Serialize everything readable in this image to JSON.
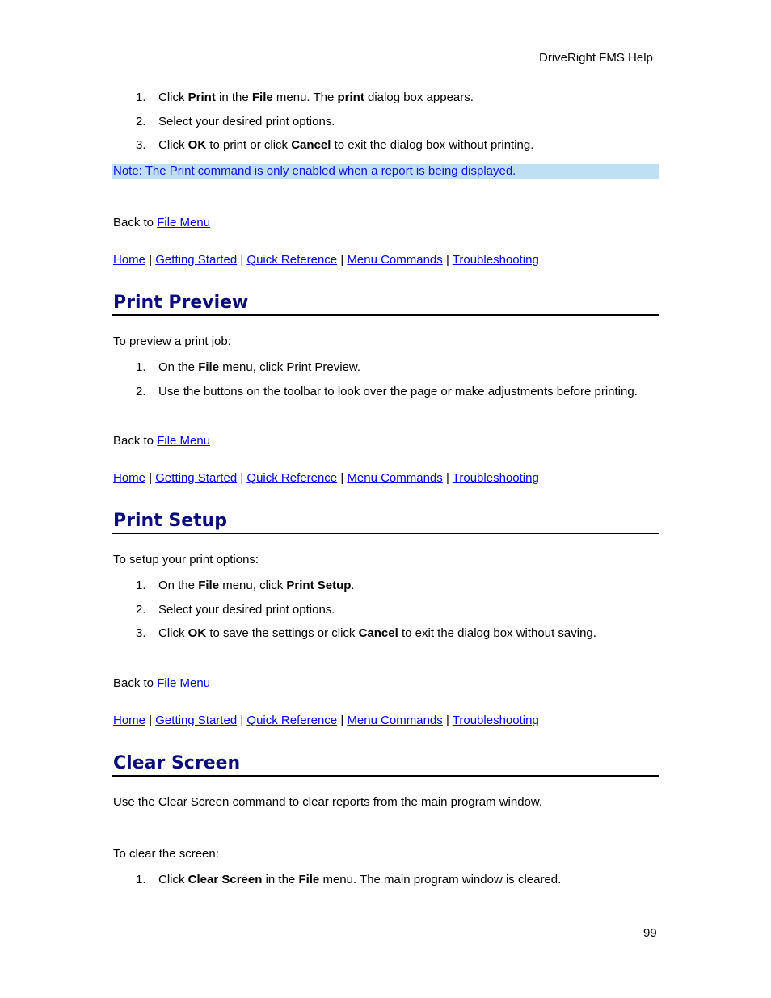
{
  "header": {
    "title": "DriveRight FMS Help"
  },
  "footer": {
    "page_number": "99"
  },
  "print_section": {
    "steps": [
      {
        "num": "1.",
        "parts": [
          "Click ",
          "Print",
          " in the ",
          "File",
          " menu. The ",
          "print",
          " dialog box appears."
        ]
      },
      {
        "num": "2.",
        "text": "Select your desired print options."
      },
      {
        "num": "3.",
        "parts": [
          "Click ",
          "OK",
          " to print or click ",
          "Cancel",
          " to exit the dialog box without printing."
        ]
      }
    ],
    "note": "Note: The Print command is only enabled when a report is being displayed.",
    "back_prefix": "Back to ",
    "back_link": "File Menu"
  },
  "nav": {
    "links": [
      "Home",
      "Getting Started",
      "Quick Reference",
      "Menu Commands",
      "Troubleshooting"
    ],
    "separator": "|"
  },
  "print_preview": {
    "heading": "Print Preview",
    "intro": "To preview a print job:",
    "steps": [
      {
        "num": "1.",
        "parts": [
          "On the ",
          "File",
          " menu, click Print Preview."
        ]
      },
      {
        "num": "2.",
        "text": "Use the buttons on the toolbar to look over the page or make adjustments before printing."
      }
    ],
    "back_prefix": "Back to ",
    "back_link": "File Menu"
  },
  "print_setup": {
    "heading": "Print Setup",
    "intro": "To setup your print options:",
    "steps": [
      {
        "num": "1.",
        "parts": [
          "On the ",
          "File",
          " menu, click ",
          "Print Setup",
          "."
        ]
      },
      {
        "num": "2.",
        "text": "Select your desired print options."
      },
      {
        "num": "3.",
        "parts": [
          "Click ",
          "OK",
          " to save the settings or click ",
          "Cancel",
          " to exit the dialog box without saving."
        ]
      }
    ],
    "back_prefix": "Back to ",
    "back_link": "File Menu"
  },
  "clear_screen": {
    "heading": "Clear Screen",
    "description": "Use the Clear Screen command to clear reports from the main program window.",
    "intro": "To clear the screen:",
    "steps": [
      {
        "num": "1.",
        "parts": [
          "Click ",
          "Clear Screen",
          " in the ",
          "File",
          " menu. The main program window is cleared."
        ]
      }
    ]
  }
}
